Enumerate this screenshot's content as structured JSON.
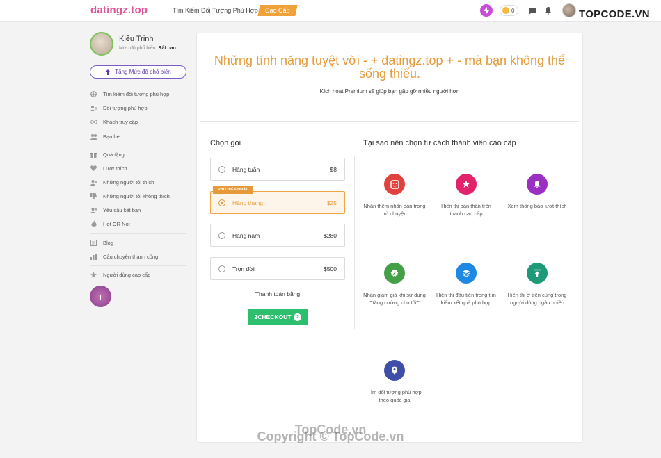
{
  "header": {
    "logo": "datingz.top",
    "nav_match": "Tìm Kiếm Đối Tượng Phù Hợp",
    "premium": "Cao Cấp",
    "coins": "0",
    "brand_badge": "TOPCODE.VN"
  },
  "profile": {
    "name": "Kiều Trinh",
    "popularity_label": "Mức độ phổ biến:",
    "popularity_value": "Rất cao",
    "boost_button": "Tăng Mức độ phổ biến"
  },
  "sidebar": {
    "items": [
      {
        "label": "Tìm kiếm đối tượng phù hợp",
        "icon": "globe-icon"
      },
      {
        "label": "Đối tượng phù hợp",
        "icon": "users-icon"
      },
      {
        "label": "Khách truy cập",
        "icon": "eye-icon"
      },
      {
        "label": "Bạn bè",
        "icon": "friends-icon"
      },
      {
        "label": "Quà tặng",
        "icon": "gift-icon"
      },
      {
        "label": "Lượt thích",
        "icon": "heart-icon"
      },
      {
        "label": "Những người tôi thích",
        "icon": "user-plus-icon"
      },
      {
        "label": "Những người tôi không thích",
        "icon": "thumbs-down-icon"
      },
      {
        "label": "Yêu cầu kết bạn",
        "icon": "user-add-icon"
      },
      {
        "label": "Hot OR Not",
        "icon": "fire-icon"
      },
      {
        "label": "Blog",
        "icon": "blog-icon"
      },
      {
        "label": "Câu chuyện thành công",
        "icon": "chart-icon"
      },
      {
        "label": "Người dùng cao cấp",
        "icon": "star-icon"
      }
    ]
  },
  "main": {
    "headline": "Những tính năng tuyệt vời - + datingz.top + - mà bạn không thể sống thiếu.",
    "subline": "Kích hoạt Premium sẽ giúp bạn gặp gỡ nhiều người hơn",
    "choose_plan": "Chọn gói",
    "why_premium": "Tại sao nên chọn tư cách thành viên cao cấp",
    "popular_badge": "PHỔ BIẾN NHẤT",
    "plans": [
      {
        "name": "Hàng tuần",
        "price": "$8"
      },
      {
        "name": "Hàng tháng",
        "price": "$25"
      },
      {
        "name": "Hàng năm",
        "price": "$280"
      },
      {
        "name": "Trọn đời",
        "price": "$500"
      }
    ],
    "pay_with": "Thanh toán bằng",
    "checkout": "2CHECKOUT",
    "checkout_num": "2",
    "features": [
      {
        "text": "Nhận thêm nhãn dán trong trò chuyện",
        "color": "#e0433f",
        "icon": "sticker-icon"
      },
      {
        "text": "Hiển thị bản thân trên thanh cao cấp",
        "color": "#e2226a",
        "icon": "star-icon"
      },
      {
        "text": "Xem thông báo lượt thích",
        "color": "#9b2fc1",
        "icon": "bell-icon"
      },
      {
        "text": "Nhận giảm giá khi sử dụng \"\"tăng cường cho tôi\"\"",
        "color": "#43a047",
        "icon": "discount-icon"
      },
      {
        "text": "Hiển thị đầu tiên trong tìm kiếm kết quả phù hợp",
        "color": "#1e88e5",
        "icon": "layers-icon"
      },
      {
        "text": "Hiển thị ở trên cùng trong người dùng ngẫu nhiên",
        "color": "#1f9a79",
        "icon": "arrow-top-icon"
      },
      {
        "text": "Tìm đối tượng phù hợp theo quốc gia",
        "color": "#3f4fa8",
        "icon": "location-icon"
      }
    ]
  },
  "watermarks": {
    "center": "TopCode.vn",
    "copyright": "Copyright © TopCode.vn"
  }
}
